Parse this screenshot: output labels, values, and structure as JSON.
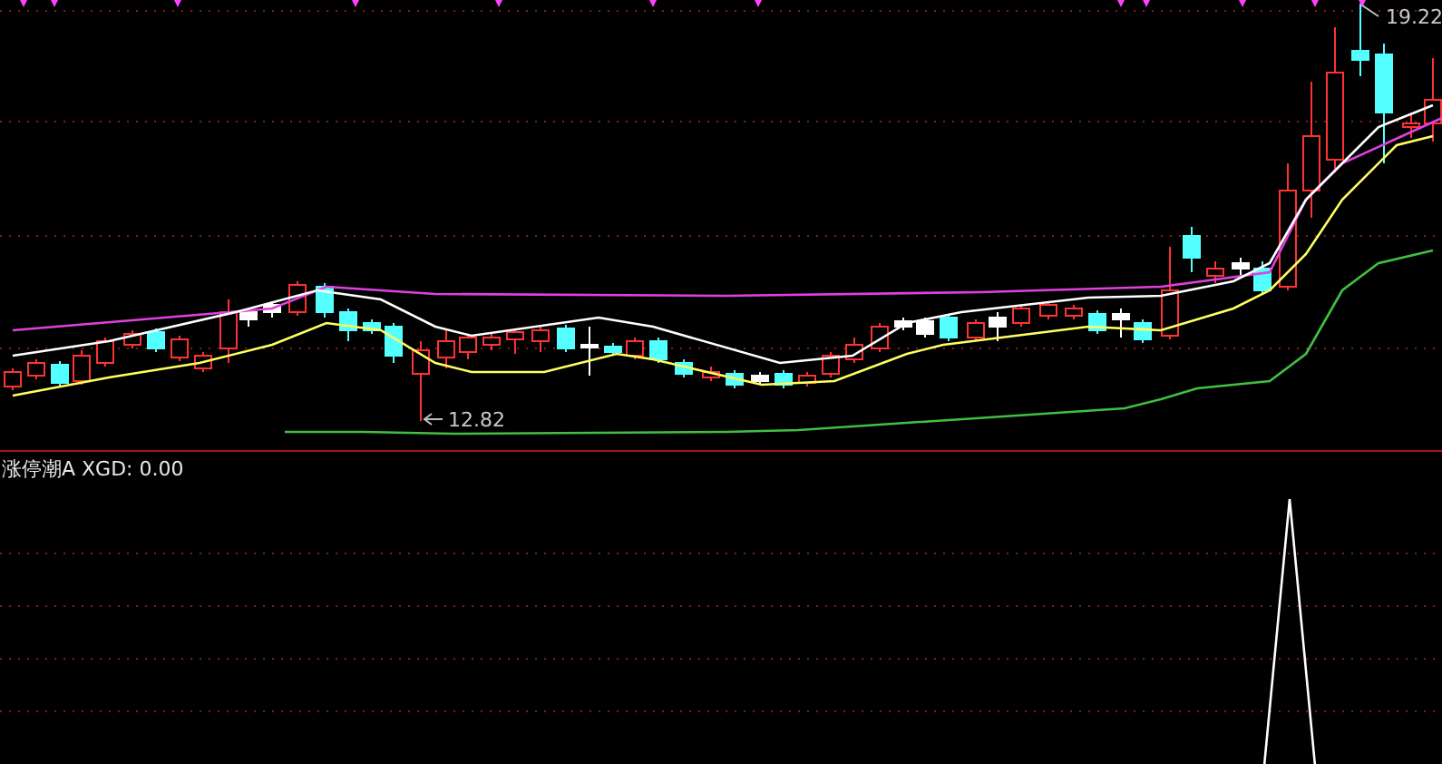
{
  "main_chart": {
    "high_label": "19.22",
    "low_label": "12.82"
  },
  "indicator_panel": {
    "title": "涨停潮A XGD: 0.00"
  }
}
